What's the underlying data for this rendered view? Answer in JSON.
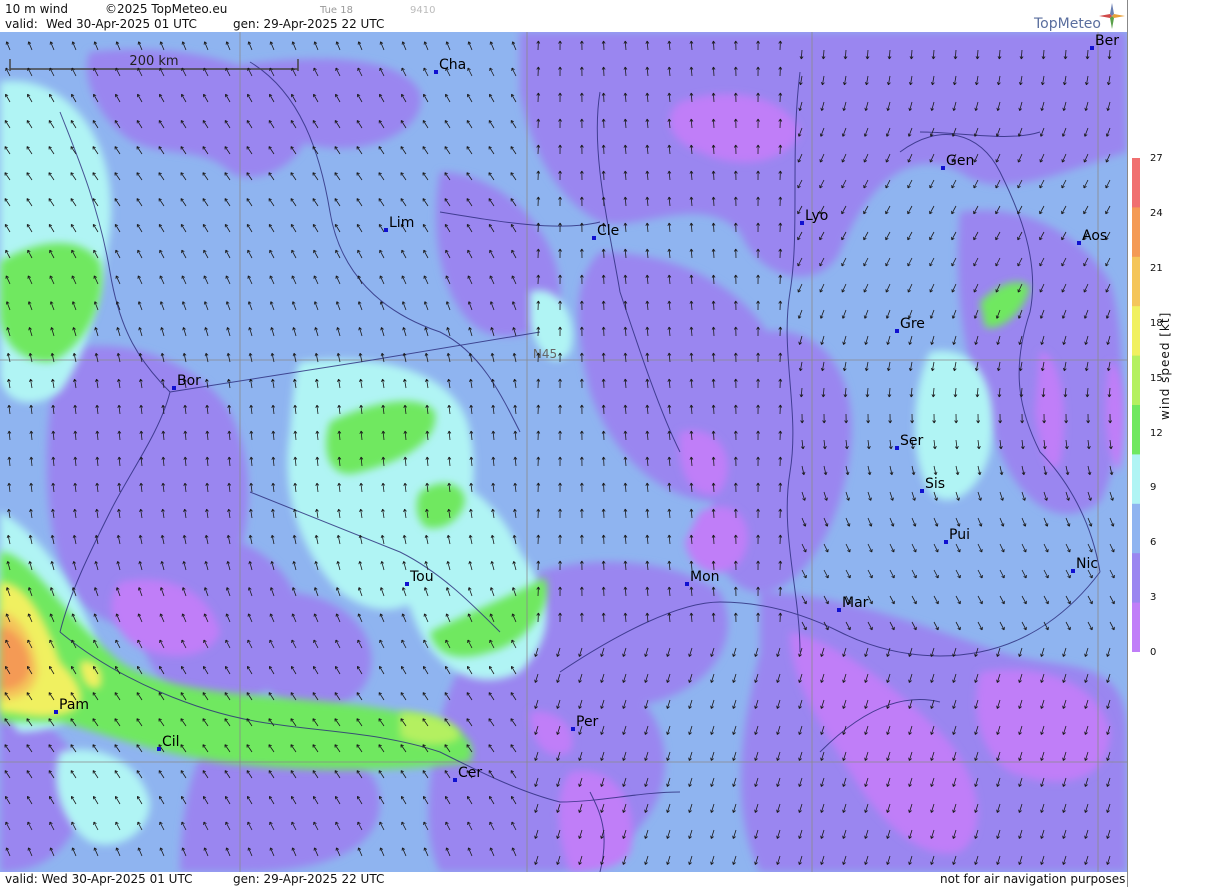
{
  "header": {
    "product": "10 m wind",
    "copyright": "©2025 TopMeteo.eu",
    "step": "Tue 18",
    "code": "9410",
    "valid_label": "valid:",
    "valid": "Wed  30-Apr-2025  01 UTC",
    "gen": "gen: 29-Apr-2025 22 UTC"
  },
  "logo": {
    "text": "TopMeteo",
    "icon": "compass-star-icon"
  },
  "map": {
    "scale": "200 km",
    "lat_label": "N45",
    "cities": [
      "Ber",
      "Cha",
      "Gen",
      "Lim",
      "Lyo",
      "Cle",
      "Aos",
      "Gre",
      "Bor",
      "Ser",
      "Sis",
      "Pui",
      "Nic",
      "Tou",
      "Mon",
      "Mar",
      "Pam",
      "Per",
      "Cil",
      "Cer"
    ]
  },
  "legend": {
    "title": "wind speed [kt]",
    "ticks": [
      "27",
      "24",
      "21",
      "18",
      "15",
      "12",
      "9",
      "6",
      "3",
      "0"
    ],
    "colors": [
      "#f07070",
      "#f49a55",
      "#f4c55a",
      "#f0f060",
      "#b4f060",
      "#70e860",
      "#b0f4f4",
      "#8fb4f0",
      "#9a86f0",
      "#c07ef8"
    ]
  },
  "footer": {
    "valid": "valid:  Wed  30-Apr-2025  01 UTC",
    "gen": "gen: 29-Apr-2025 22 UTC",
    "disclaimer": "not for air navigation purposes"
  }
}
